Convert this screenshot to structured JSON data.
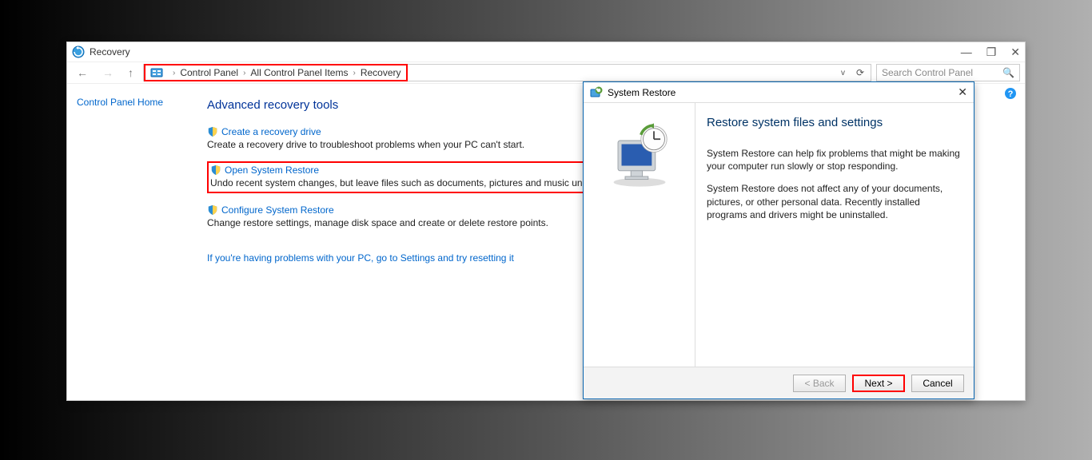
{
  "window": {
    "title": "Recovery",
    "controls": {
      "minimize": "—",
      "maximize": "❐",
      "close": "✕"
    }
  },
  "breadcrumb": {
    "items": [
      "Control Panel",
      "All Control Panel Items",
      "Recovery"
    ],
    "refresh": "⟳"
  },
  "search": {
    "placeholder": "Search Control Panel"
  },
  "sidebar": {
    "home_link": "Control Panel Home"
  },
  "main": {
    "heading": "Advanced recovery tools",
    "tools": [
      {
        "link": "Create a recovery drive",
        "desc": "Create a recovery drive to troubleshoot problems when your PC can't start."
      },
      {
        "link": "Open System Restore",
        "desc": "Undo recent system changes, but leave files such as documents, pictures and music unchanged."
      },
      {
        "link": "Configure System Restore",
        "desc": "Change restore settings, manage disk space and create or delete restore points."
      }
    ],
    "troubleshoot": "If you're having problems with your PC, go to Settings and try resetting it"
  },
  "dialog": {
    "title": "System Restore",
    "heading": "Restore system files and settings",
    "para1": "System Restore can help fix problems that might be making your computer run slowly or stop responding.",
    "para2": "System Restore does not affect any of your documents, pictures, or other personal data. Recently installed programs and drivers might be uninstalled.",
    "buttons": {
      "back": "< Back",
      "next": "Next >",
      "cancel": "Cancel"
    }
  }
}
